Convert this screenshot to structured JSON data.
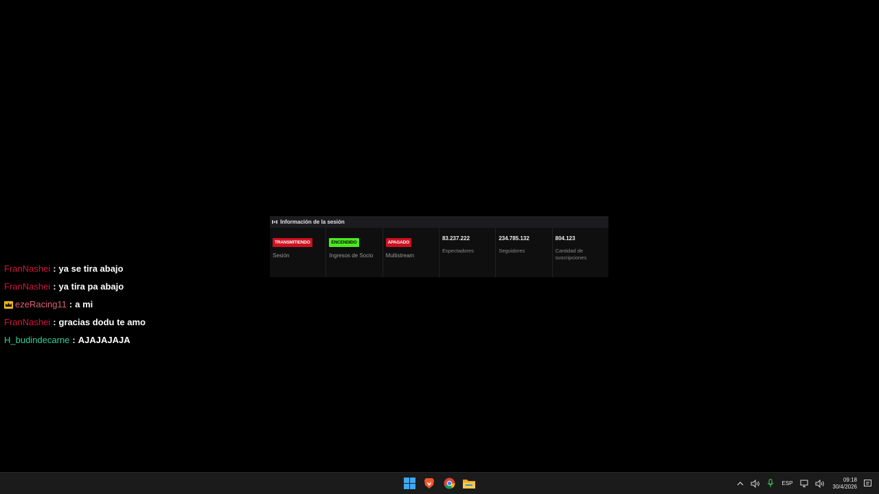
{
  "session_panel": {
    "title": "Información de la sesión",
    "header_icon": "panel-icon",
    "status_cells": [
      {
        "badge": "TRANSMITIENDO",
        "badge_color": "#d0101f",
        "label": "Sesión"
      },
      {
        "badge": "ENCENDIDO",
        "badge_color": "#4bea1f",
        "label": "Ingresos de Socio"
      },
      {
        "badge": "APAGADO",
        "badge_color": "#d0101f",
        "label": "Multistream"
      }
    ],
    "stats": [
      {
        "value": "83.237.222",
        "label": "Espectadores"
      },
      {
        "value": "234.785.132",
        "label": "Seguidores"
      },
      {
        "value": "804.123",
        "label": "Cantidad de suscripciones"
      }
    ]
  },
  "chat": {
    "messages": [
      {
        "user": "FranNashei",
        "user_color": "#d4163c",
        "message": "ya se tira abajo",
        "badge": ""
      },
      {
        "user": "FranNashei",
        "user_color": "#d4163c",
        "message": "ya tira pa abajo",
        "badge": ""
      },
      {
        "user": "ezeRacing11",
        "user_color": "#e0607a",
        "message": "a mi",
        "badge": "crown-icon"
      },
      {
        "user": "FranNashei",
        "user_color": "#d4163c",
        "message": "gracias dodu te amo",
        "badge": ""
      },
      {
        "user": "H_budindecarne",
        "user_color": "#2ed39a",
        "message": "AJAJAJAJA",
        "badge": ""
      }
    ],
    "separator": ":"
  },
  "taskbar": {
    "apps": [
      "windows-start-icon",
      "brave-browser-icon",
      "chrome-icon",
      "file-explorer-icon"
    ],
    "tray": {
      "language": "ESP",
      "time": "09:18",
      "date": "30/4/2026"
    }
  }
}
